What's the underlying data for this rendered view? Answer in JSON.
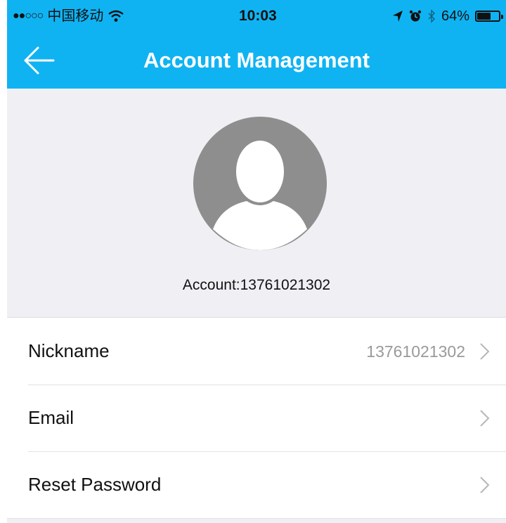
{
  "status_bar": {
    "carrier": "中国移动",
    "time": "10:03",
    "battery_percent": "64%",
    "battery_level": 0.64,
    "icons": [
      "signal-dots-icon",
      "wifi-icon",
      "location-arrow-icon",
      "alarm-icon",
      "bluetooth-icon",
      "battery-icon"
    ]
  },
  "nav": {
    "title": "Account Management",
    "back_icon": "back-arrow-icon"
  },
  "profile": {
    "avatar_icon": "user-avatar-icon",
    "account_label": "Account:13761021302"
  },
  "rows": [
    {
      "label": "Nickname",
      "value": "13761021302"
    },
    {
      "label": "Email",
      "value": ""
    },
    {
      "label": "Reset Password",
      "value": ""
    }
  ],
  "colors": {
    "accent": "#10b3f2",
    "header_bg": "#efeff4",
    "avatar": "#8e8e8e"
  }
}
